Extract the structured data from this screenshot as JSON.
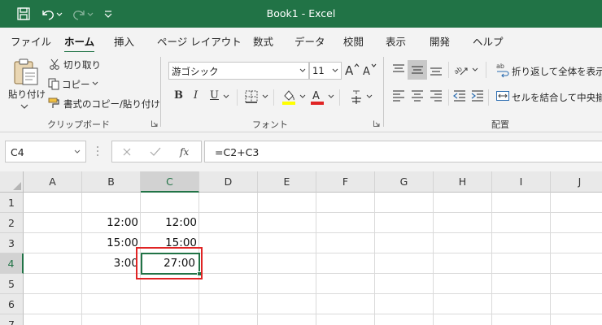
{
  "titlebar": {
    "title": "Book1  -  Excel"
  },
  "tabs": [
    "ファイル",
    "ホーム",
    "挿入",
    "ページ レイアウト",
    "数式",
    "データ",
    "校閲",
    "表示",
    "開発",
    "ヘルプ"
  ],
  "active_tab": "ホーム",
  "ribbon": {
    "clipboard": {
      "paste_label": "貼り付け",
      "cut_label": "切り取り",
      "copy_label": "コピー",
      "format_painter_label": "書式のコピー/貼り付け",
      "group_label": "クリップボード"
    },
    "font": {
      "font_name": "游ゴシック",
      "font_size": "11",
      "bold": "B",
      "italic": "I",
      "underline": "U",
      "group_label": "フォント"
    },
    "alignment": {
      "wrap_text_label": "折り返して全体を表示す",
      "merge_center_label": "セルを結合して中央揃え",
      "group_label": "配置"
    }
  },
  "formula_bar": {
    "name_box": "C4",
    "formula": "=C2+C3"
  },
  "sheet": {
    "columns": [
      "A",
      "B",
      "C",
      "D",
      "E",
      "F",
      "G",
      "H",
      "I",
      "J"
    ],
    "selected_column": "C",
    "rows": [
      "1",
      "2",
      "3",
      "4",
      "5",
      "6",
      "7"
    ],
    "selected_row": "4",
    "cells": {
      "B2": "12:00",
      "C2": "12:00",
      "B3": "15:00",
      "C3": "15:00",
      "B4": "3:00",
      "C4": "27:00"
    }
  },
  "colors": {
    "accent": "#217346",
    "highlight_box": "#e02424",
    "font_color_bar": "#e02424",
    "fill_color_bar": "#ffff00"
  }
}
